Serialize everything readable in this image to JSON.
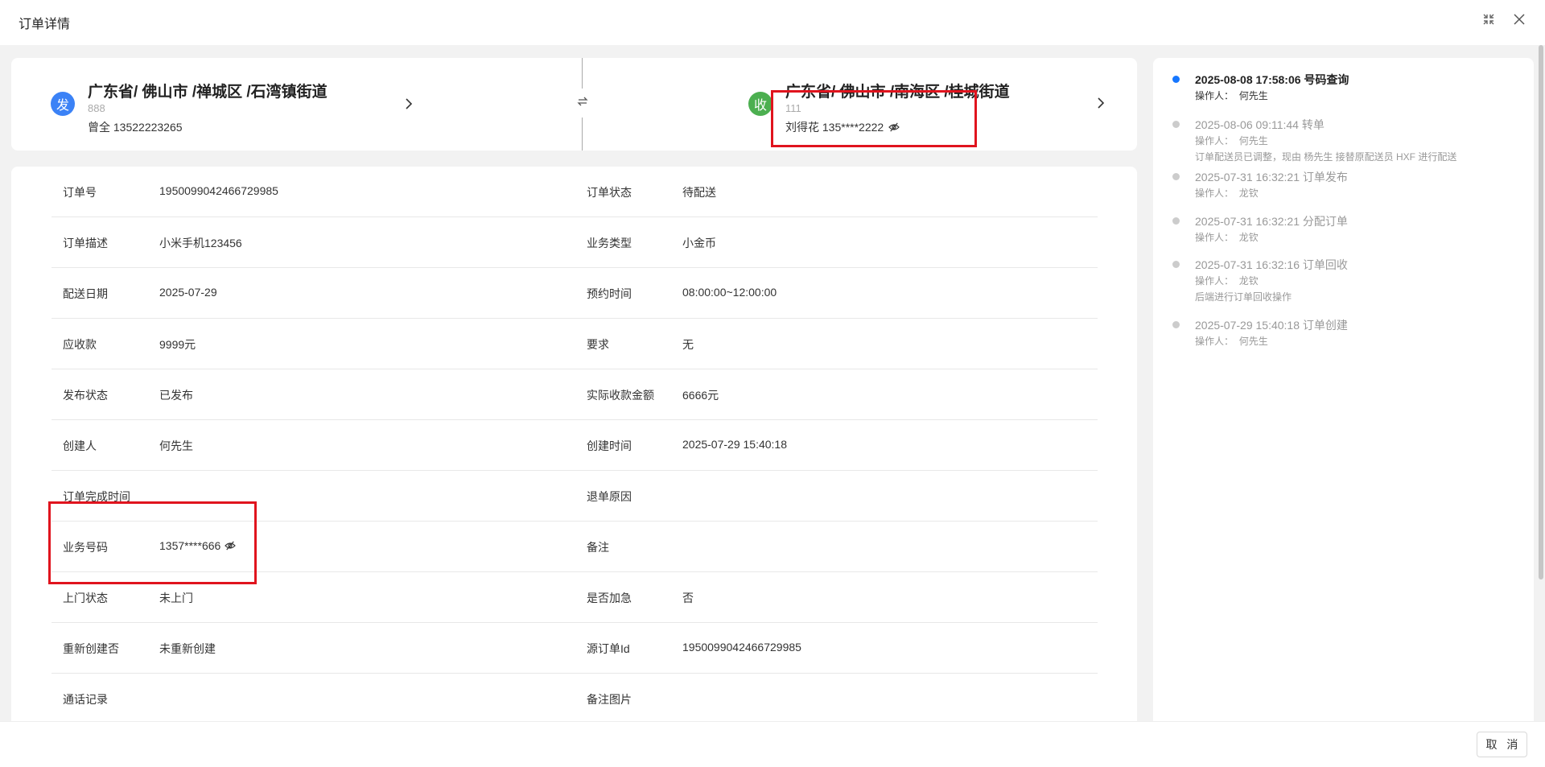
{
  "header": {
    "title": "订单详情",
    "icons": [
      "collapse-icon",
      "close-icon"
    ]
  },
  "sender": {
    "badge": "发",
    "badge_color": "#3b82f6",
    "address": "广东省/ 佛山市 /禅城区 /石湾镇街道",
    "detail": "888",
    "contact": "曾全 13522223265"
  },
  "receiver": {
    "badge": "收",
    "badge_color": "#4caf50",
    "address": "广东省/ 佛山市 /南海区 /桂城街道",
    "detail": "111",
    "contact": "刘得花 135****2222"
  },
  "details": [
    {
      "l1": "订单号",
      "v1": "1950099042466729985",
      "l2": "订单状态",
      "v2": "待配送"
    },
    {
      "l1": "订单描述",
      "v1": "小米手机123456",
      "l2": "业务类型",
      "v2": "小金币"
    },
    {
      "l1": "配送日期",
      "v1": "2025-07-29",
      "l2": "预约时间",
      "v2": "08:00:00~12:00:00"
    },
    {
      "l1": "应收款",
      "v1": "9999元",
      "l2": "要求",
      "v2": "无"
    },
    {
      "l1": "发布状态",
      "v1": "已发布",
      "l2": "实际收款金额",
      "v2": "6666元"
    },
    {
      "l1": "创建人",
      "v1": "何先生",
      "l2": "创建时间",
      "v2": "2025-07-29 15:40:18"
    },
    {
      "l1": "订单完成时间",
      "v1": "",
      "l2": "退单原因",
      "v2": ""
    },
    {
      "l1": "业务号码",
      "v1": "1357****666",
      "l2": "备注",
      "v2": ""
    },
    {
      "l1": "上门状态",
      "v1": "未上门",
      "l2": "是否加急",
      "v2": "否"
    },
    {
      "l1": "重新创建否",
      "v1": "未重新创建",
      "l2": "源订单Id",
      "v2": "1950099042466729985"
    },
    {
      "l1": "通话记录",
      "v1": "",
      "l2": "备注图片",
      "v2": ""
    }
  ],
  "timeline": [
    {
      "time": "2025-08-08 17:58:06 号码查询",
      "op_label": "操作人：",
      "op": "何先生",
      "note": "",
      "active": true
    },
    {
      "time": "2025-08-06 09:11:44 转单",
      "op_label": "操作人：",
      "op": "何先生",
      "note": "订单配送员已调整，现由 杨先生 接替原配送员 HXF 进行配送",
      "active": false
    },
    {
      "time": "2025-07-31 16:32:21 订单发布",
      "op_label": "操作人：",
      "op": "龙钦",
      "note": "",
      "active": false
    },
    {
      "time": "2025-07-31 16:32:21 分配订单",
      "op_label": "操作人：",
      "op": "龙钦",
      "note": "",
      "active": false
    },
    {
      "time": "2025-07-31 16:32:16 订单回收",
      "op_label": "操作人：",
      "op": "龙钦",
      "note": "后端进行订单回收操作",
      "active": false
    },
    {
      "time": "2025-07-29 15:40:18 订单创建",
      "op_label": "操作人：",
      "op": "何先生",
      "note": "",
      "active": false
    }
  ],
  "footer": {
    "cancel_label": "取 消"
  },
  "colors": {
    "accent": "#1677ff",
    "highlight": "#e0141e"
  }
}
